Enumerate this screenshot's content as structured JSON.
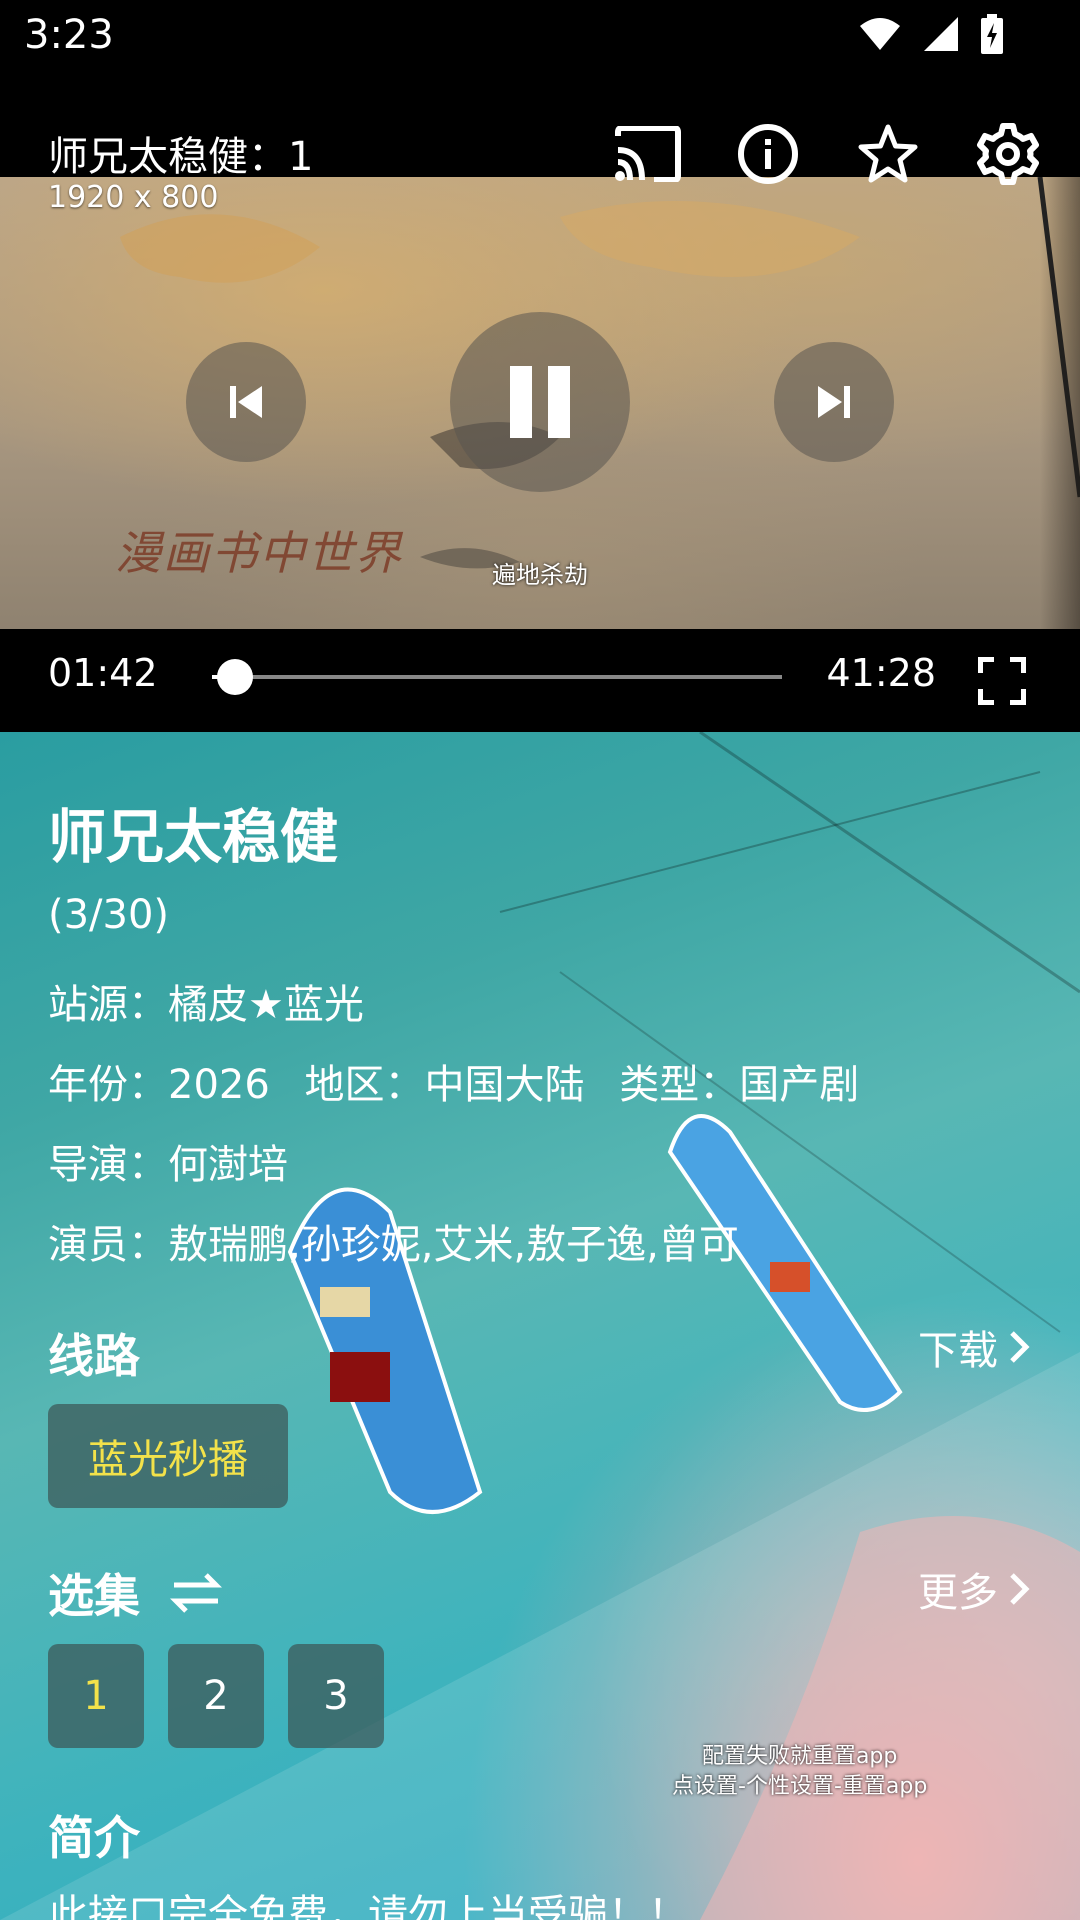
{
  "status_bar": {
    "time": "3:23",
    "icons": [
      "wifi-icon",
      "cellular-icon",
      "battery-charging-icon"
    ]
  },
  "player": {
    "title": "师兄太稳健：1",
    "resolution": "1920 x 800",
    "top_actions": [
      "cast-icon",
      "info-icon",
      "star-icon",
      "settings-icon"
    ],
    "video_watermark": "漫画书中世界",
    "video_caption": "遍地杀劫",
    "current_time": "01:42",
    "total_time": "41:28",
    "progress": 0.041
  },
  "details": {
    "title": "师兄太稳健",
    "episode_count": "(3/30)",
    "source": "站源：橘皮★蓝光",
    "year": "年份：2026",
    "region": "地区：中国大陆",
    "genre": "类型：国产剧",
    "director": "导演：何澍培",
    "cast": "演员：敖瑞鹏,孙珍妮,艾米,敖子逸,曾可"
  },
  "routes": {
    "label": "线路",
    "download_label": "下载",
    "items": [
      {
        "label": "蓝光秒播",
        "active": true
      }
    ]
  },
  "episodes": {
    "label": "选集",
    "more_label": "更多",
    "items": [
      {
        "label": "1",
        "active": true
      },
      {
        "label": "2",
        "active": false
      },
      {
        "label": "3",
        "active": false
      }
    ]
  },
  "background_overlay": {
    "line1": "配置失败就重置app",
    "line2": "点设置-个性设置-重置app"
  },
  "intro": {
    "label": "简介",
    "text": "此接口完全免费，请勿上当受骗！！"
  },
  "colors": {
    "accent": "#f3e24a",
    "chip_bg": "#3c5a5a"
  }
}
